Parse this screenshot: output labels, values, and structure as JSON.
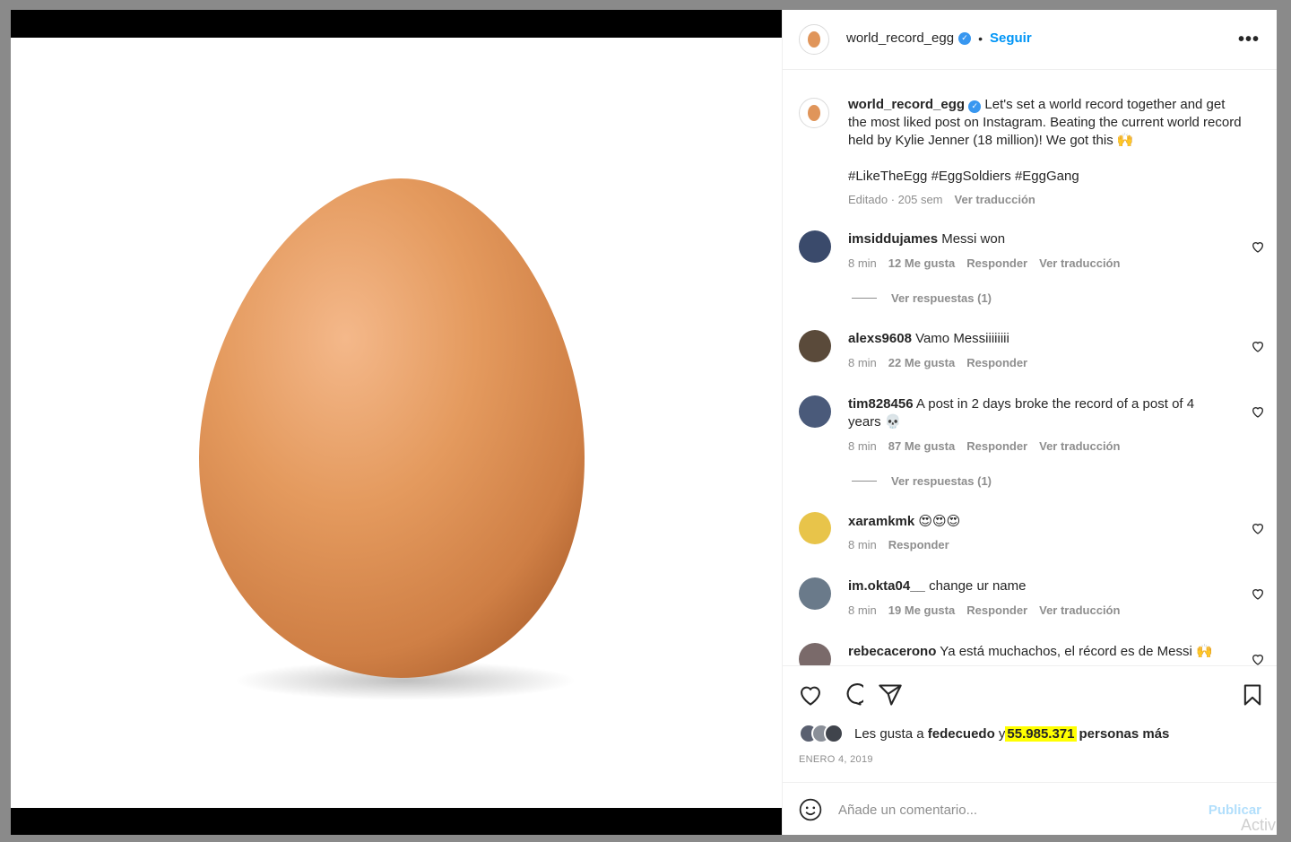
{
  "post": {
    "username": "world_record_egg",
    "verified_mark": "✓",
    "separator": "•",
    "follow_label": "Seguir",
    "more_label": "•••",
    "caption": "Let's set a world record together and get the most liked post on Instagram. Beating the current world record held by Kylie Jenner (18 million)! We got this 🙌",
    "hashtags": "#LikeTheEgg #EggSoldiers #EggGang",
    "edited": "Editado · 205 sem",
    "translate": "Ver traducción"
  },
  "comments": [
    {
      "user": "imsiddujames",
      "text": "Messi won",
      "time": "8 min",
      "likes": "12 Me gusta",
      "reply": "Responder",
      "translate": "Ver traducción",
      "replies": "Ver respuestas (1)",
      "avatar_color": "#3a4a6b"
    },
    {
      "user": "alexs9608",
      "text": "Vamo Messiiiiiiii",
      "time": "8 min",
      "likes": "22 Me gusta",
      "reply": "Responder",
      "avatar_color": "#5a4a3a"
    },
    {
      "user": "tim828456",
      "text": "A post in 2 days broke the record of a post of 4 years 💀",
      "time": "8 min",
      "likes": "87 Me gusta",
      "reply": "Responder",
      "translate": "Ver traducción",
      "replies": "Ver respuestas (1)",
      "avatar_color": "#4a5a7a"
    },
    {
      "user": "xaramkmk",
      "text": "😍😍😍",
      "time": "8 min",
      "reply": "Responder",
      "avatar_color": "#e8c44a"
    },
    {
      "user": "im.okta04__",
      "text": "change ur name",
      "time": "8 min",
      "likes": "19 Me gusta",
      "reply": "Responder",
      "translate": "Ver traducción",
      "avatar_color": "#6a7a8a"
    },
    {
      "user": "rebecacerono",
      "text": "Ya está muchachos, el récord es de Messi 🙌",
      "avatar_color": "#7a6a6a"
    }
  ],
  "likes": {
    "prefix": "Les gusta a",
    "user": "fedecuedo",
    "connector": "y",
    "count": "55.985.371",
    "suffix": "personas más"
  },
  "date": "ENERO 4, 2019",
  "composer": {
    "placeholder": "Añade un comentario...",
    "publish": "Publicar"
  },
  "watermark": "Activ",
  "colors": {
    "accent": "#0095f6",
    "highlight": "#ffff00",
    "hashtag": "#00376b",
    "egg": "#e0955a"
  }
}
